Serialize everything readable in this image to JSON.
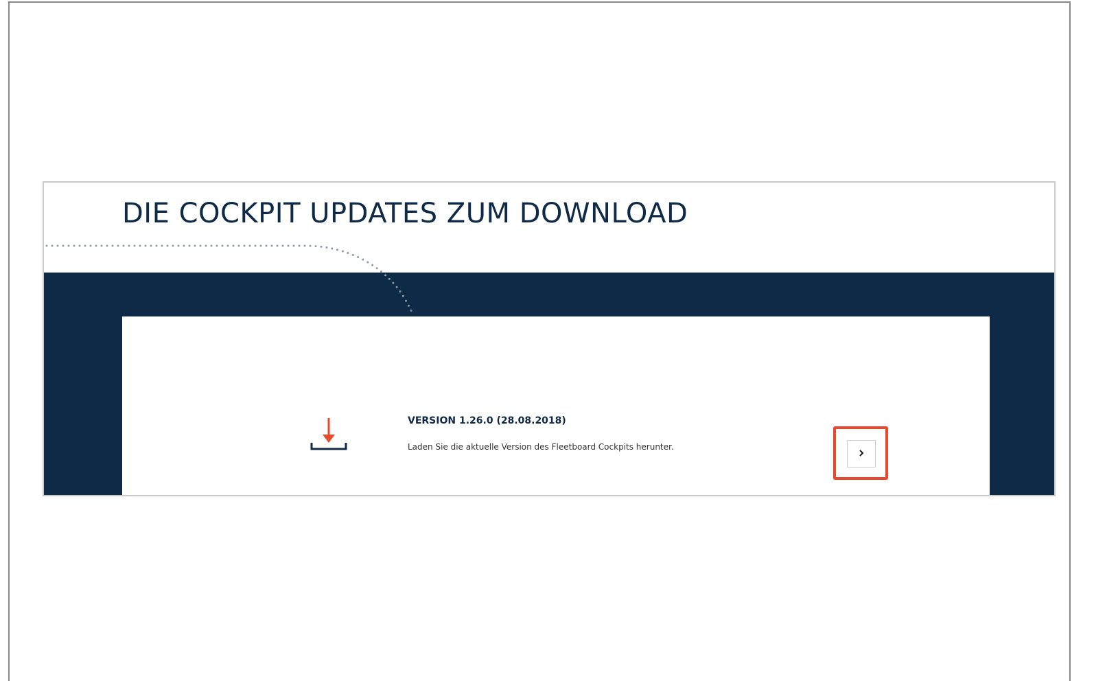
{
  "section": {
    "title": "DIE COCKPIT UPDATES ZUM DOWNLOAD"
  },
  "download_item": {
    "icon": "download-icon",
    "version_label": "VERSION 1.26.0 (28.08.2018)",
    "description": "Laden Sie die aktuelle Version des Fleetboard Cockpits herunter.",
    "action_icon": "chevron-right-icon"
  },
  "colors": {
    "navy": "#0f2a47",
    "accent_orange": "#e8492b",
    "highlight_red": "#e8492b",
    "dotted_line": "#8c99a8"
  }
}
